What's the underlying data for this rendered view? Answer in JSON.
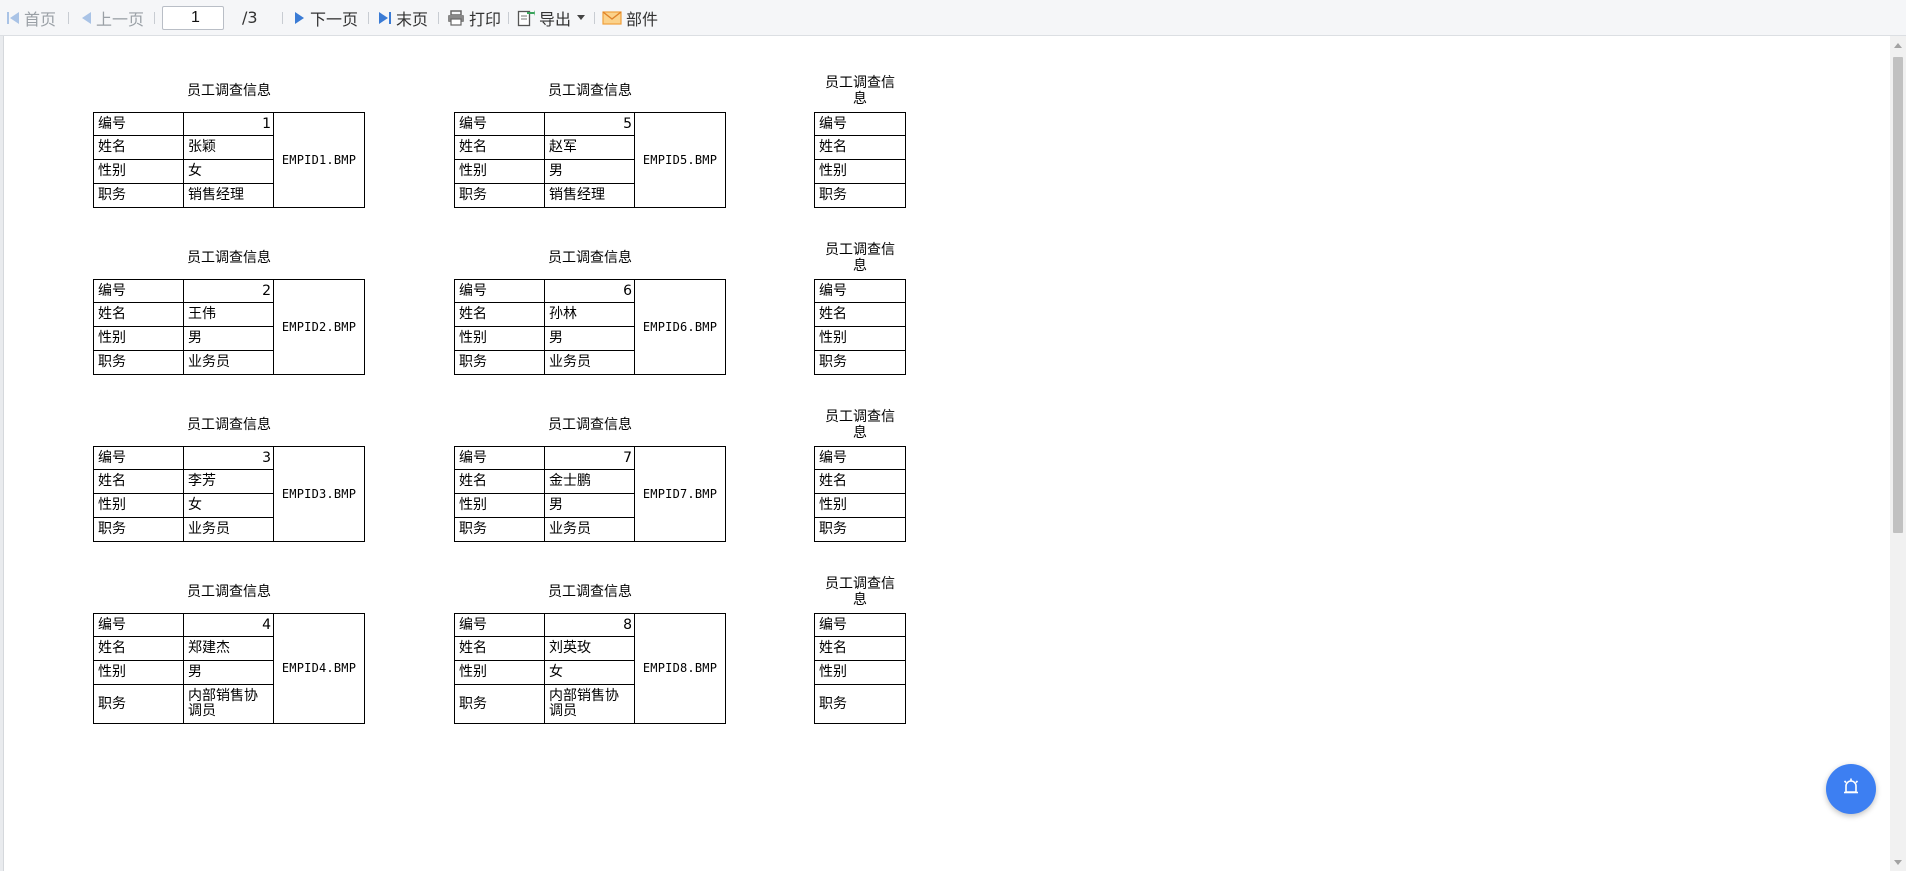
{
  "toolbar": {
    "first_label": "首页",
    "prev_label": "上一页",
    "page_value": "1",
    "page_total": "/3",
    "next_label": "下一页",
    "last_label": "末页",
    "print_label": "打印",
    "export_label": "导出",
    "mail_label": "部件"
  },
  "report": {
    "card_title": "员工调查信息",
    "labels": [
      "编号",
      "姓名",
      "性别",
      "职务"
    ],
    "cards": [
      {
        "id": "1",
        "name": "张颖",
        "gender": "女",
        "title": "销售经理",
        "photo": "EMPID1.BMP"
      },
      {
        "id": "2",
        "name": "王伟",
        "gender": "男",
        "title": "业务员",
        "photo": "EMPID2.BMP"
      },
      {
        "id": "3",
        "name": "李芳",
        "gender": "女",
        "title": "业务员",
        "photo": "EMPID3.BMP"
      },
      {
        "id": "4",
        "name": "郑建杰",
        "gender": "男",
        "title": "内部销售协调员",
        "photo": "EMPID4.BMP"
      },
      {
        "id": "5",
        "name": "赵军",
        "gender": "男",
        "title": "销售经理",
        "photo": "EMPID5.BMP"
      },
      {
        "id": "6",
        "name": "孙林",
        "gender": "男",
        "title": "业务员",
        "photo": "EMPID6.BMP"
      },
      {
        "id": "7",
        "name": "金士鹏",
        "gender": "男",
        "title": "业务员",
        "photo": "EMPID7.BMP"
      },
      {
        "id": "8",
        "name": "刘英玫",
        "gender": "女",
        "title": "内部销售协调员",
        "photo": "EMPID8.BMP"
      }
    ]
  },
  "colors": {
    "toolbar_bg": "#f5f6f8",
    "icon_blue": "#3a7bd5",
    "float_button": "#3d7ff2",
    "mail_icon": "#f0a03c"
  },
  "icons": [
    "first-page-icon",
    "prev-page-icon",
    "next-page-icon",
    "last-page-icon",
    "printer-icon",
    "export-icon",
    "dropdown-caret-icon",
    "mail-icon",
    "alarm-icon"
  ]
}
